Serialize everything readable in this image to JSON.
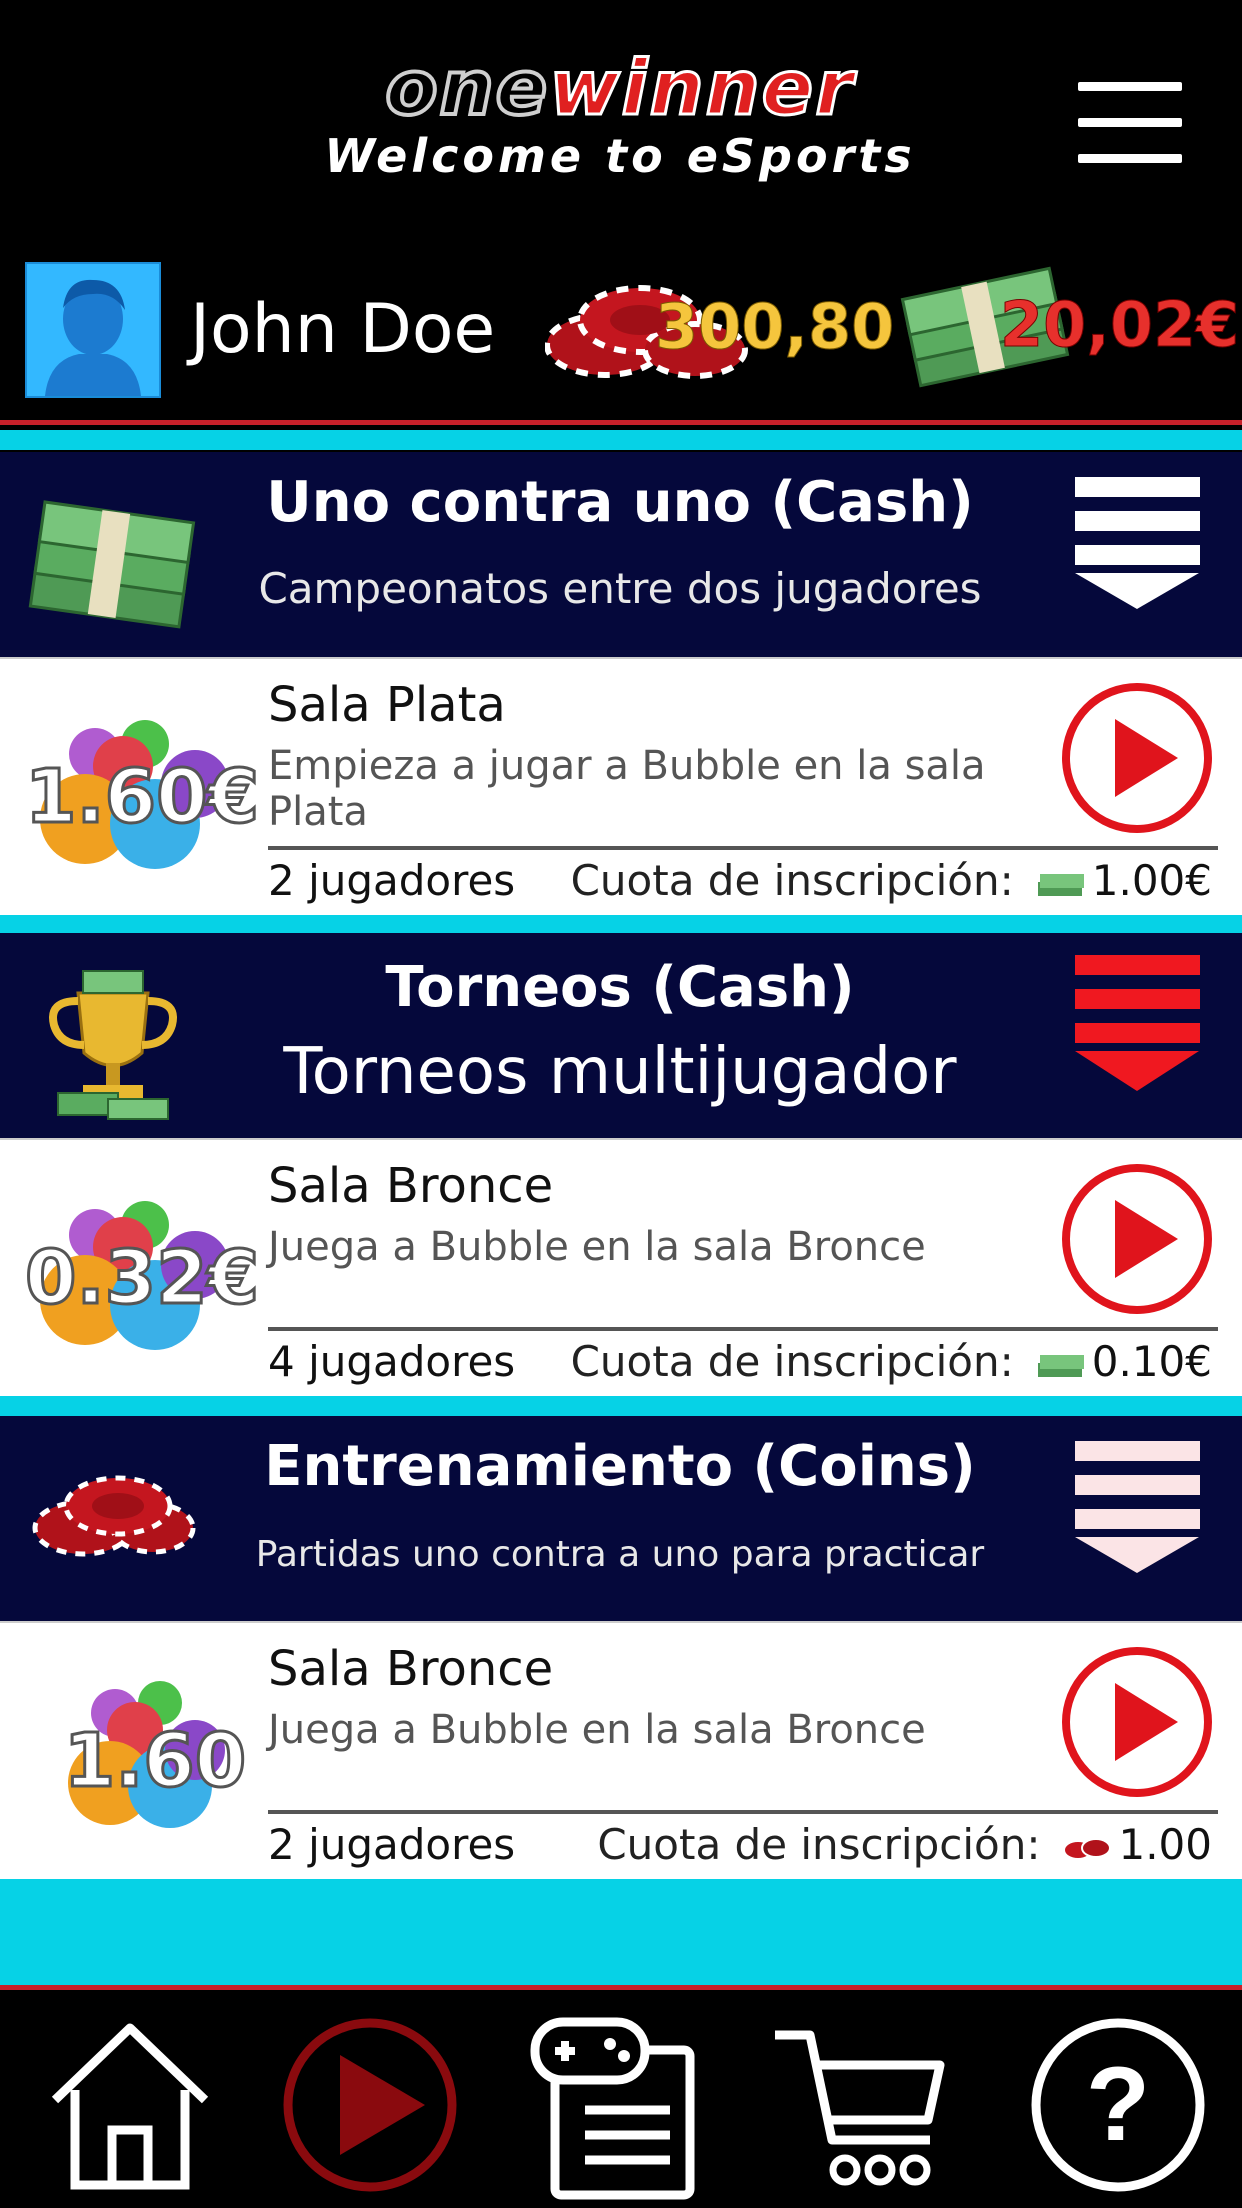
{
  "header": {
    "brand_one": "one",
    "brand_winner": "winner",
    "tagline": "Welcome to eSports"
  },
  "user": {
    "name": "John Doe",
    "coins": "300,80",
    "cash": "20,02€"
  },
  "sections": [
    {
      "title": "Uno contra uno (Cash)",
      "subtitle": "Campeonatos entre dos jugadores",
      "room": {
        "name": "Sala Plata",
        "description": "Empieza a jugar a Bubble en la sala Plata",
        "prize": "1.60€",
        "players": "2 jugadores",
        "fee_label": "Cuota de inscripción:",
        "fee": "1.00€"
      }
    },
    {
      "title": "Torneos (Cash)",
      "subtitle": "Torneos multijugador",
      "room": {
        "name": "Sala Bronce",
        "description": "Juega a Bubble en la sala Bronce",
        "prize": "0.32€",
        "players": "4 jugadores",
        "fee_label": "Cuota de inscripción:",
        "fee": "0.10€"
      }
    },
    {
      "title": "Entrenamiento (Coins)",
      "subtitle": "Partidas uno contra a uno para practicar",
      "room": {
        "name": "Sala Bronce",
        "description": "Juega a Bubble en la sala Bronce",
        "prize": "1.60",
        "players": "2 jugadores",
        "fee_label": "Cuota de inscripción:",
        "fee": "1.00"
      }
    }
  ],
  "nav": [
    "home-icon",
    "play-icon",
    "gamepad-list-icon",
    "cart-icon",
    "help-icon"
  ],
  "colors": {
    "accent_red": "#e02020",
    "cyan": "#06d2e6",
    "navy": "#05083b",
    "coin_gold": "#f5c53d"
  }
}
